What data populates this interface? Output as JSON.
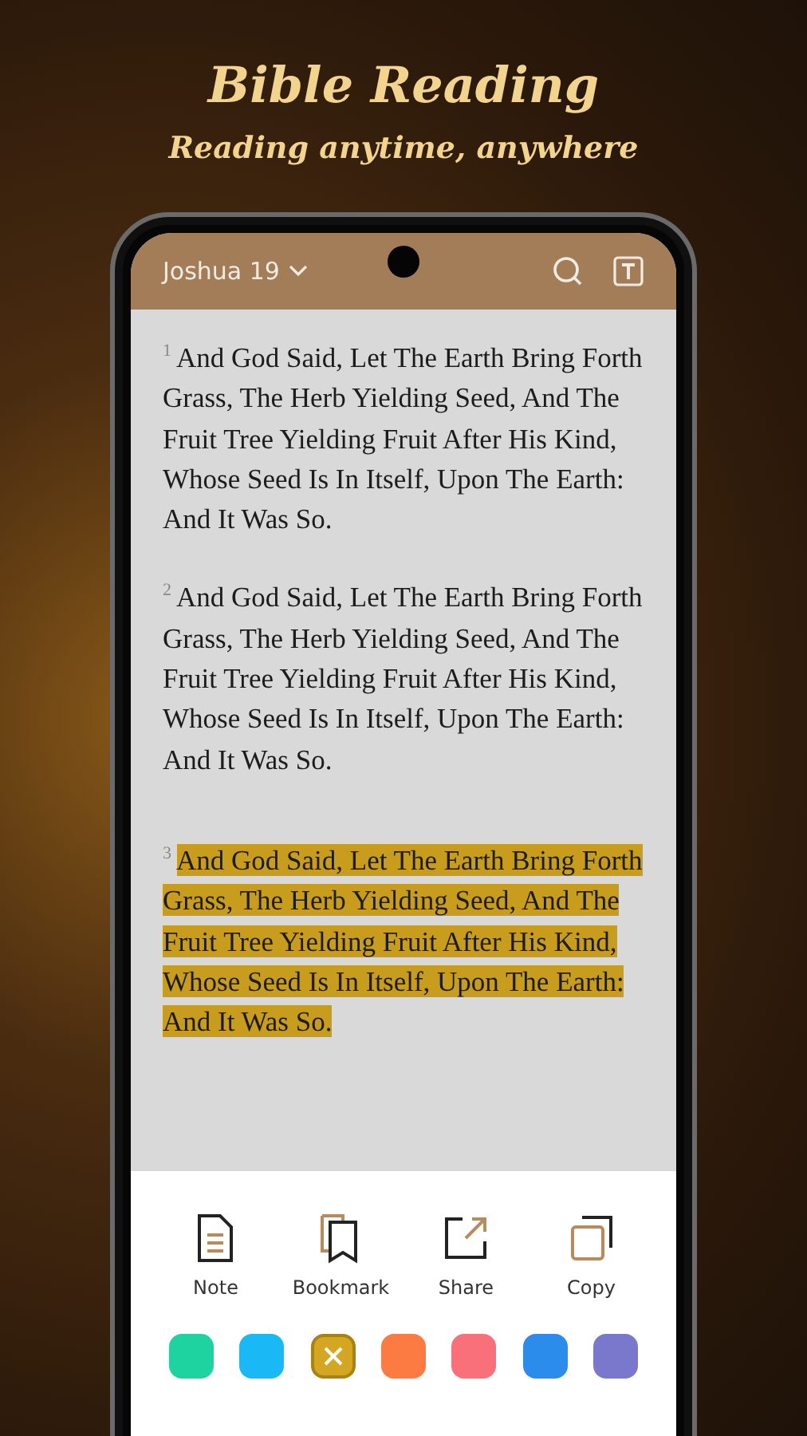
{
  "title": "Bible Reading",
  "subtitle": "Reading anytime, anywhere",
  "header": {
    "book": "Joshua 19"
  },
  "verses": [
    {
      "number": "1",
      "text": "And God Said, Let The Earth Bring Forth Grass, The Herb Yielding Seed, And The Fruit Tree Yielding Fruit After His Kind, Whose Seed Is In Itself, Upon The Earth: And It Was So.",
      "highlighted": false
    },
    {
      "number": "2",
      "text": "And God Said, Let The Earth Bring Forth Grass, The Herb Yielding Seed, And The Fruit Tree Yielding Fruit After His Kind, Whose Seed Is In Itself, Upon The Earth: And It Was So.",
      "highlighted": false
    },
    {
      "number": "3",
      "text": "And God Said, Let The Earth Bring Forth Grass, The Herb Yielding Seed, And The Fruit Tree Yielding Fruit After His Kind, Whose Seed Is In Itself, Upon The Earth: And It Was So.",
      "highlighted": true
    }
  ],
  "actions": [
    {
      "kind": "note",
      "label": "Note"
    },
    {
      "kind": "bookmark",
      "label": "Bookmark"
    },
    {
      "kind": "share",
      "label": "Share"
    },
    {
      "kind": "copy",
      "label": "Copy"
    }
  ],
  "colors": [
    {
      "color": "#1ed3a0",
      "selected": false
    },
    {
      "color": "#1ab8f5",
      "selected": false
    },
    {
      "color": "#d4a622",
      "selected": true
    },
    {
      "color": "#fb7b43",
      "selected": false
    },
    {
      "color": "#f9707a",
      "selected": false
    },
    {
      "color": "#2b8cec",
      "selected": false
    },
    {
      "color": "#7a78cc",
      "selected": false
    }
  ]
}
